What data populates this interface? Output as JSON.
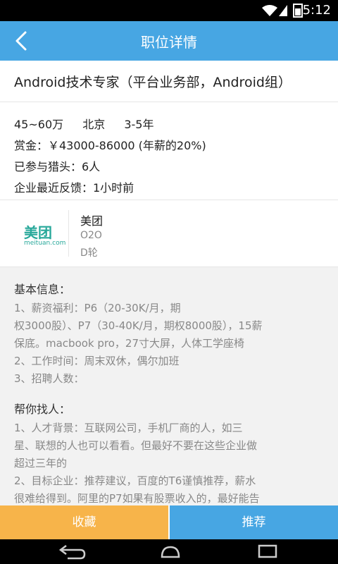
{
  "status_bar": {
    "time": "5:12"
  },
  "app_bar": {
    "title": "职位详情"
  },
  "job": {
    "title": "Android技术专家（平台业务部，Android组）"
  },
  "meta": {
    "salary": "45~60万",
    "city": "北京",
    "experience": "3-5年",
    "bounty": "赏金：￥43000-86000 (年薪的20%)",
    "headhunters": "已参与猎头：6人",
    "feedback": "企业最近反馈：1小时前"
  },
  "company": {
    "logo_text": "美团",
    "logo_sub": "meituan.com",
    "name": "美团",
    "field": "O2O",
    "round": "D轮"
  },
  "basic_info": {
    "heading": "基本信息：",
    "lines": [
      "1、薪资福利：P6（20-30K/月，期",
      "权3000股）、P7（30-40K/月，期权8000股），15薪",
      "保底。macbook pro，27寸大屏，人体工学座椅",
      "2、工作时间：周末双休，偶尔加班",
      "3、招聘人数："
    ]
  },
  "help_find": {
    "heading": "帮你找人：",
    "lines": [
      "1、人才背景：互联网公司，手机厂商的人，如三",
      "星、联想的人也可以看看。但最好不要在这些企业做",
      "超过三年的",
      "2、目标企业：推荐建议，百度的T6谨慎推荐，薪水",
      "很难给得到。阿里的P7如果有股票收入的，最好能告"
    ]
  },
  "actions": {
    "favorite": "收藏",
    "recommend": "推荐"
  },
  "colors": {
    "primary": "#47a6e3",
    "favorite": "#f7b44a",
    "brand_logo": "#27a89a"
  }
}
